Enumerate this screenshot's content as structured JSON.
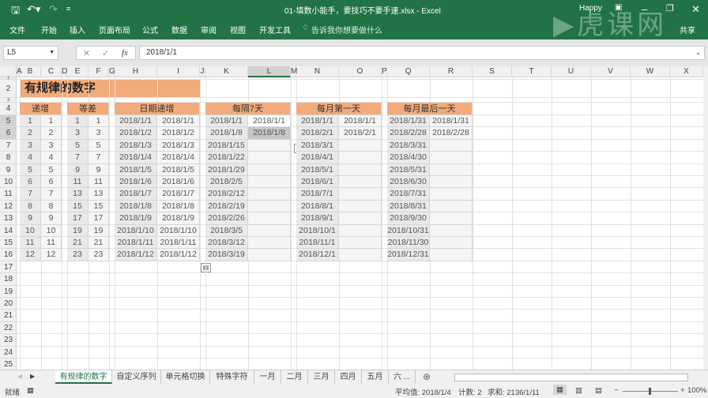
{
  "window": {
    "title": "01-填数小能手，要技巧不要手速.xlsx  -  Excel",
    "user": "Happy",
    "share": "共享",
    "watermark": "虎课网"
  },
  "ribbon": {
    "tabs": [
      "文件",
      "开始",
      "插入",
      "页面布局",
      "公式",
      "数据",
      "审阅",
      "视图",
      "开发工具"
    ],
    "tell_me": "告诉我你想要做什么"
  },
  "formula_bar": {
    "name_box": "L5",
    "formula": "2018/1/1",
    "fx": "fx"
  },
  "columns": [
    "A",
    "B",
    "C",
    "D",
    "E",
    "F",
    "G",
    "H",
    "I",
    "J",
    "K",
    "L",
    "M",
    "N",
    "O",
    "P",
    "Q",
    "R",
    "S",
    "T",
    "U",
    "V",
    "W",
    "X"
  ],
  "selected_column": "L",
  "rows": [
    1,
    2,
    3,
    4,
    5,
    6,
    7,
    8,
    9,
    10,
    11,
    12,
    13,
    14,
    15,
    16,
    17,
    18,
    19,
    20,
    21,
    22,
    23,
    24,
    25
  ],
  "sheet_title": "有规律的数字",
  "tables": [
    {
      "header": "递增",
      "cols": [
        "B",
        "C"
      ],
      "left": [
        "1",
        "2",
        "3",
        "4",
        "5",
        "6",
        "7",
        "8",
        "9",
        "10",
        "11",
        "12"
      ],
      "right": [
        "1",
        "2",
        "3",
        "4",
        "5",
        "6",
        "7",
        "8",
        "9",
        "10",
        "11",
        "12"
      ]
    },
    {
      "header": "等差",
      "cols": [
        "E",
        "F"
      ],
      "left": [
        "1",
        "3",
        "5",
        "7",
        "9",
        "11",
        "13",
        "15",
        "17",
        "19",
        "21",
        "23"
      ],
      "right": [
        "1",
        "3",
        "5",
        "7",
        "9",
        "11",
        "13",
        "15",
        "17",
        "19",
        "21",
        "23"
      ]
    },
    {
      "header": "日期递增",
      "cols": [
        "H",
        "I"
      ],
      "left": [
        "2018/1/1",
        "2018/1/2",
        "2018/1/3",
        "2018/1/4",
        "2018/1/5",
        "2018/1/6",
        "2018/1/7",
        "2018/1/8",
        "2018/1/9",
        "2018/1/10",
        "2018/1/11",
        "2018/1/12"
      ],
      "right": [
        "2018/1/1",
        "2018/1/2",
        "2018/1/3",
        "2018/1/4",
        "2018/1/5",
        "2018/1/6",
        "2018/1/7",
        "2018/1/8",
        "2018/1/9",
        "2018/1/10",
        "2018/1/11",
        "2018/1/12"
      ]
    },
    {
      "header": "每隔7天",
      "cols": [
        "K",
        "L"
      ],
      "left": [
        "2018/1/1",
        "2018/1/8",
        "2018/1/15",
        "2018/1/22",
        "2018/1/29",
        "2018/2/5",
        "2018/2/12",
        "2018/2/19",
        "2018/2/26",
        "2018/3/5",
        "2018/3/12",
        "2018/3/19"
      ],
      "right": [
        "2018/1/1",
        "2018/1/8",
        "",
        "",
        "",
        "",
        "",
        "",
        "",
        "",
        "",
        ""
      ]
    },
    {
      "header": "每月第一天",
      "cols": [
        "N",
        "O"
      ],
      "left": [
        "2018/1/1",
        "2018/2/1",
        "2018/3/1",
        "2018/4/1",
        "2018/5/1",
        "2018/6/1",
        "2018/7/1",
        "2018/8/1",
        "2018/9/1",
        "2018/10/1",
        "2018/11/1",
        "2018/12/1"
      ],
      "right": [
        "2018/1/1",
        "2018/2/1",
        "",
        "",
        "",
        "",
        "",
        "",
        "",
        "",
        "",
        ""
      ]
    },
    {
      "header": "每月最后一天",
      "cols": [
        "Q",
        "R"
      ],
      "left": [
        "2018/1/31",
        "2018/2/28",
        "2018/3/31",
        "2018/4/30",
        "2018/5/31",
        "2018/6/30",
        "2018/7/31",
        "2018/8/31",
        "2018/9/30",
        "2018/10/31",
        "2018/11/30",
        "2018/12/31"
      ],
      "right": [
        "2018/1/31",
        "2018/2/28",
        "",
        "",
        "",
        "",
        "",
        "",
        "",
        "",
        "",
        ""
      ]
    }
  ],
  "sheet_tabs": [
    "有规律的数字",
    "自定义序列",
    "单元格切换",
    "特殊字符",
    "一月",
    "二月",
    "三月",
    "四月",
    "五月",
    "六 ..."
  ],
  "active_sheet": 0,
  "status": {
    "ready": "就绪",
    "average": "平均值: 2018/1/4",
    "count": "计数: 2",
    "sum": "求和: 2136/1/11",
    "zoom": "100%"
  },
  "colors": {
    "excel_green": "#217346",
    "header_orange": "#f2ab7a"
  }
}
